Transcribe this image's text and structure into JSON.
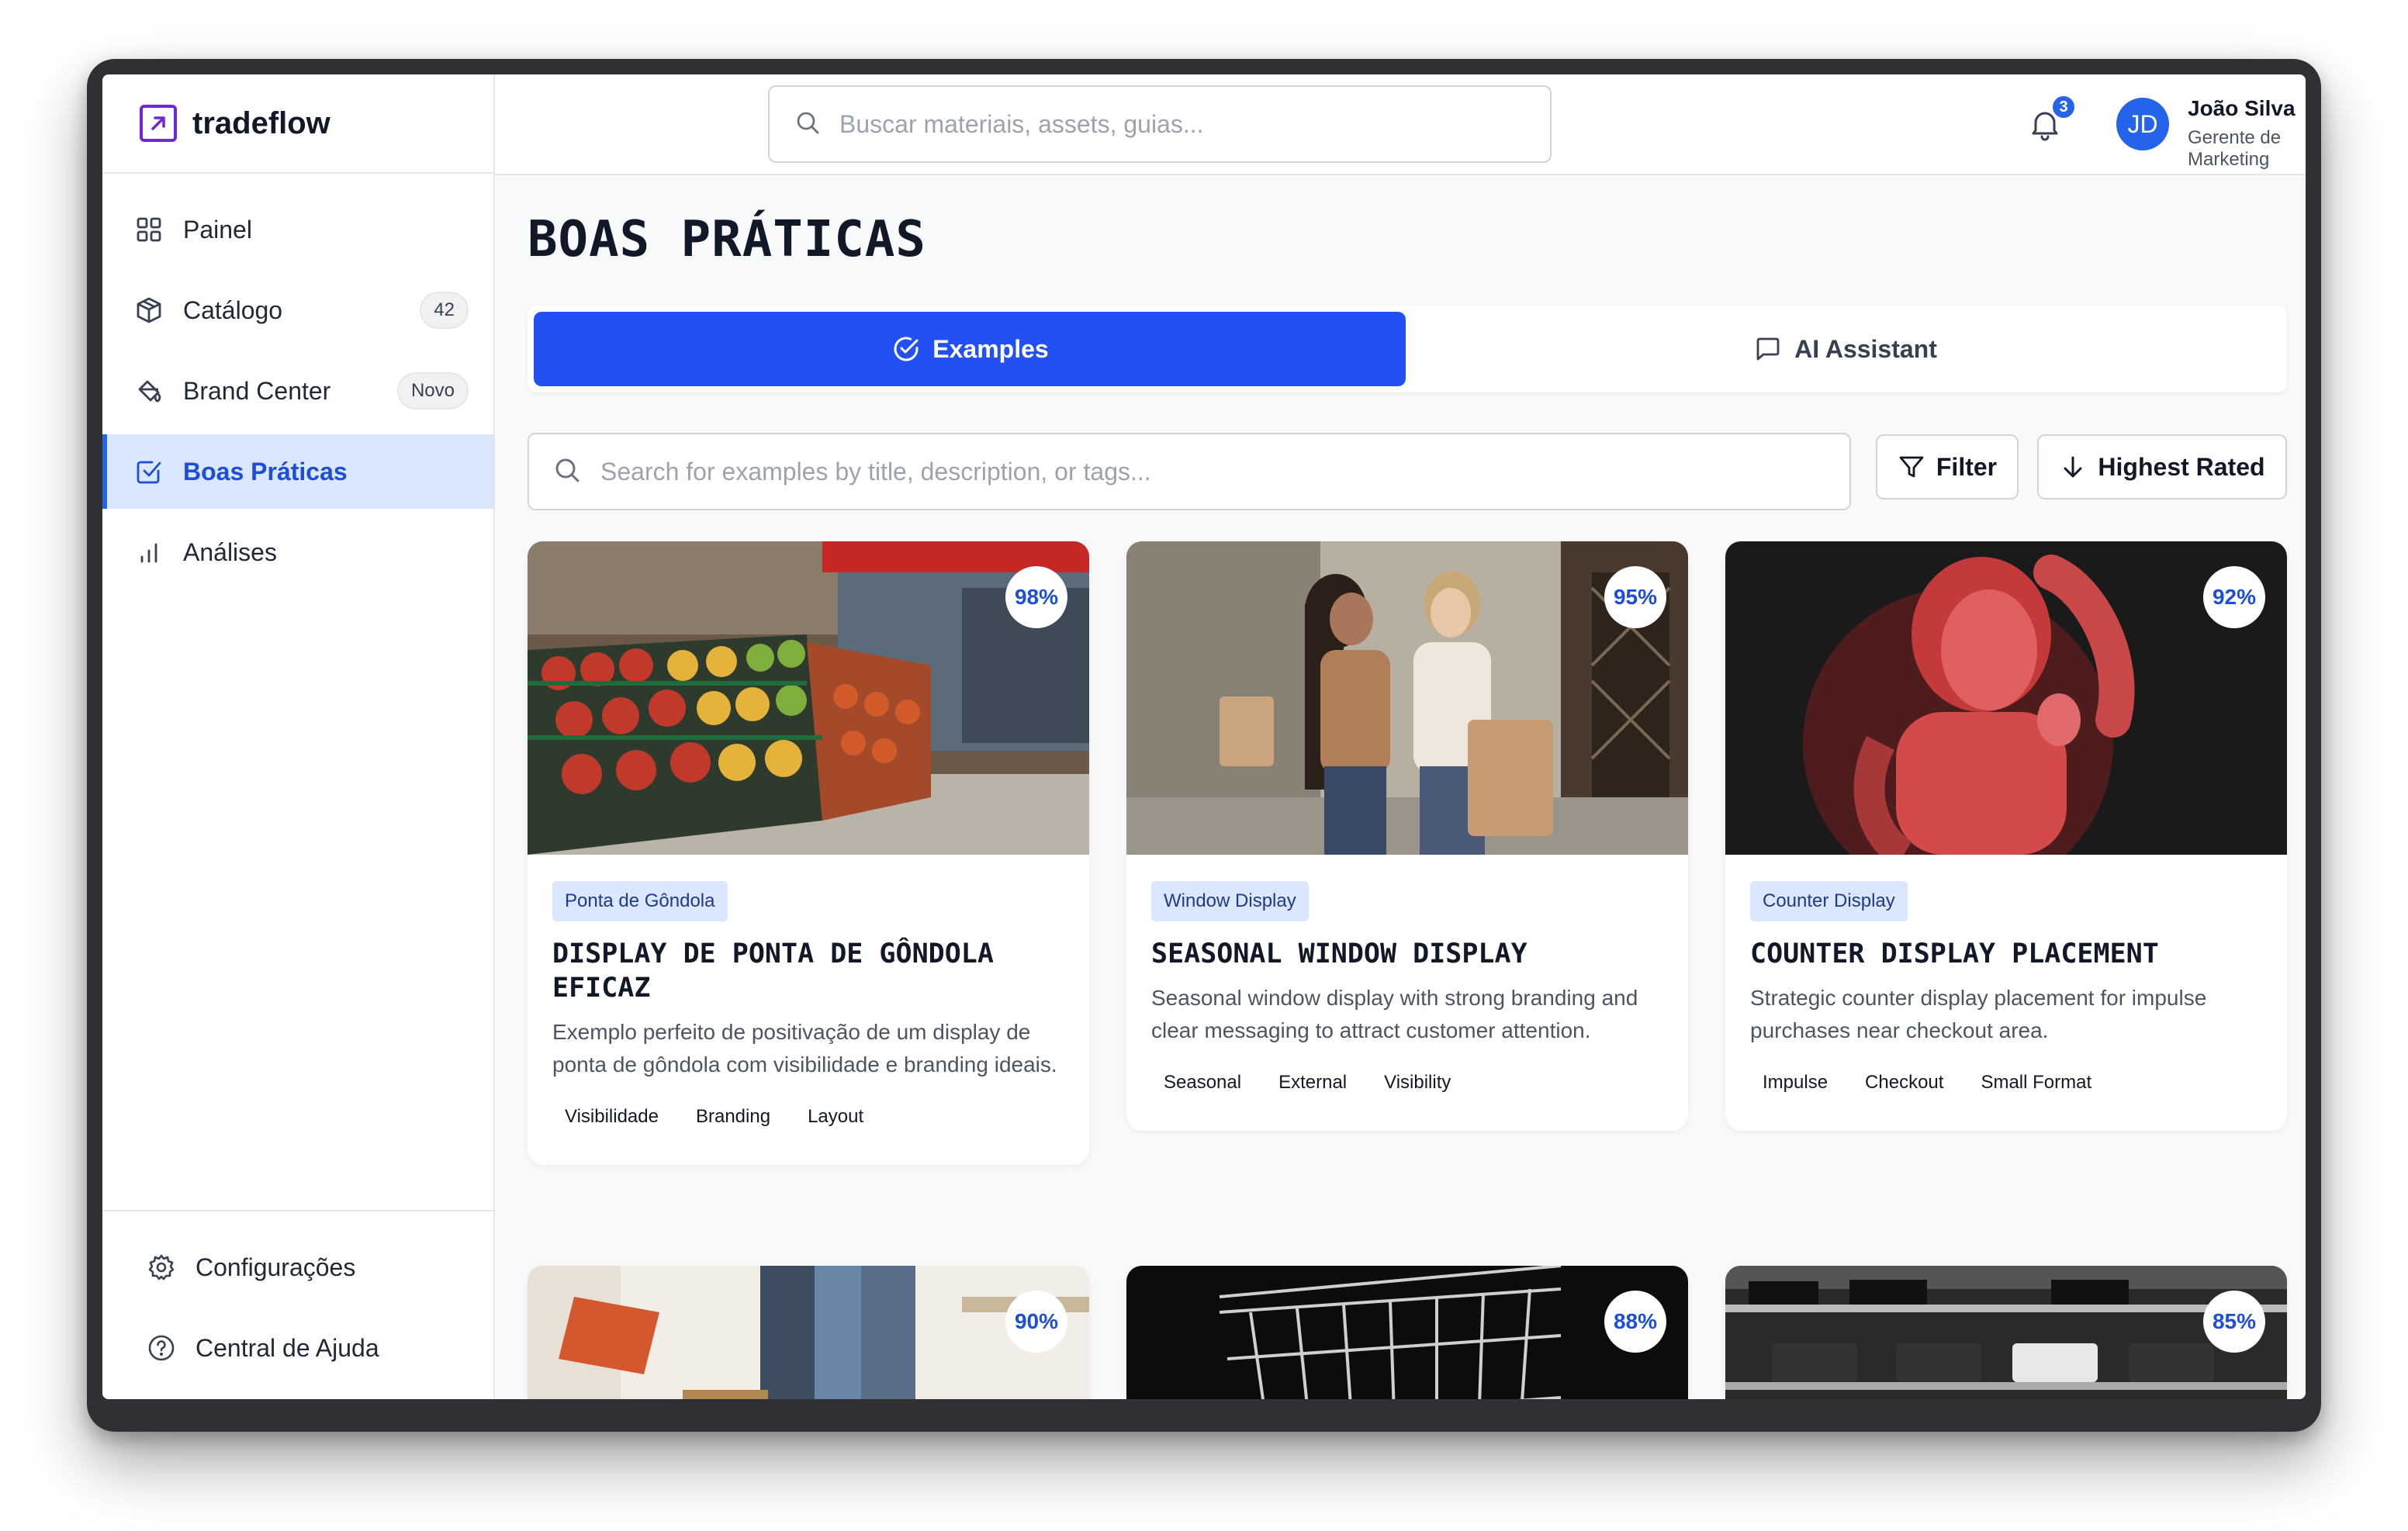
{
  "brand": {
    "name": "tradeflow"
  },
  "sidebar": {
    "items": [
      {
        "label": "Painel",
        "icon": "grid-icon"
      },
      {
        "label": "Catálogo",
        "icon": "box-icon",
        "badge": "42"
      },
      {
        "label": "Brand Center",
        "icon": "paint-bucket-icon",
        "badge": "Novo"
      },
      {
        "label": "Boas Práticas",
        "icon": "check-square-icon",
        "active": true
      },
      {
        "label": "Análises",
        "icon": "bar-chart-icon"
      }
    ],
    "bottom": [
      {
        "label": "Configurações",
        "icon": "gear-icon"
      },
      {
        "label": "Central de Ajuda",
        "icon": "help-circle-icon"
      }
    ]
  },
  "header": {
    "search_placeholder": "Buscar materiais, assets, guias...",
    "notifications_count": "3",
    "user": {
      "initials": "JD",
      "name": "João Silva",
      "role": "Gerente de Marketing"
    }
  },
  "page": {
    "title": "BOAS PRÁTICAS",
    "tabs": [
      {
        "label": "Examples",
        "icon": "check-circle-icon",
        "active": true
      },
      {
        "label": "AI Assistant",
        "icon": "message-square-icon"
      }
    ],
    "search_placeholder": "Search for examples by title, description, or tags...",
    "filter_label": "Filter",
    "sort_label": "Highest Rated"
  },
  "cards": [
    {
      "score": "98%",
      "category": "Ponta de Gôndola",
      "title": "DISPLAY DE PONTA DE GÔNDOLA EFICAZ",
      "description": "Exemplo perfeito de positivação de um display de ponta de gôndola com visibilidade e branding ideais.",
      "tags": [
        "Visibilidade",
        "Branding",
        "Layout"
      ]
    },
    {
      "score": "95%",
      "category": "Window Display",
      "title": "SEASONAL WINDOW DISPLAY",
      "description": "Seasonal window display with strong branding and clear messaging to attract customer attention.",
      "tags": [
        "Seasonal",
        "External",
        "Visibility"
      ]
    },
    {
      "score": "92%",
      "category": "Counter Display",
      "title": "COUNTER DISPLAY PLACEMENT",
      "description": "Strategic counter display placement for impulse purchases near checkout area.",
      "tags": [
        "Impulse",
        "Checkout",
        "Small Format"
      ]
    },
    {
      "score": "90%"
    },
    {
      "score": "88%"
    },
    {
      "score": "85%"
    }
  ]
}
